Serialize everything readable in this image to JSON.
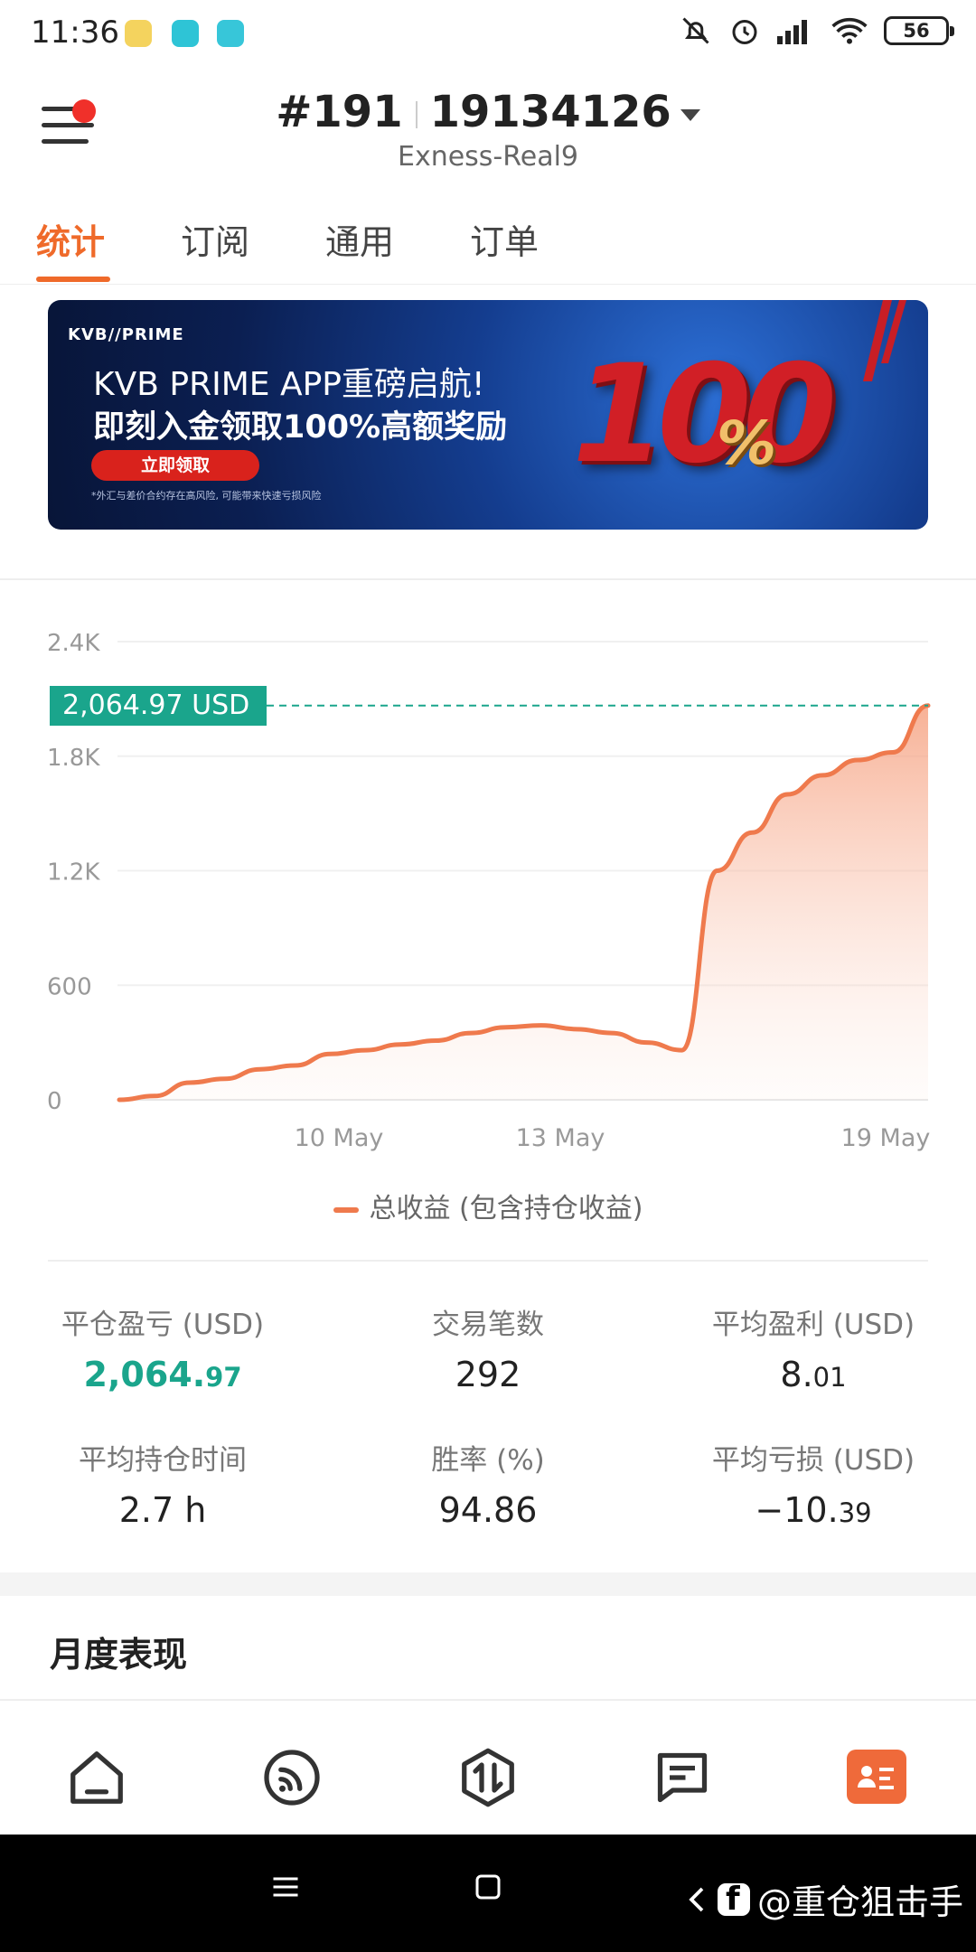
{
  "status_bar": {
    "time": "11:36",
    "battery": "56"
  },
  "header": {
    "account_prefix": "#191",
    "account_number": "19134126",
    "server": "Exness-Real9"
  },
  "tabs": [
    {
      "label": "统计",
      "active": true
    },
    {
      "label": "订阅",
      "active": false
    },
    {
      "label": "通用",
      "active": false
    },
    {
      "label": "订单",
      "active": false
    }
  ],
  "banner": {
    "brand": "KVB//PRIME",
    "line1": "KVB PRIME APP重磅启航!",
    "line2": "即刻入金领取100%高额奖励",
    "button": "立即领取",
    "fine_print": "*外汇与差价合约存在高风险, 可能带来快速亏损风险",
    "big_number": "100",
    "percent": "%"
  },
  "chart_data": {
    "type": "area",
    "y_ticks": [
      "2.4K",
      "1.8K",
      "1.2K",
      "600",
      "0"
    ],
    "x_ticks": [
      "10 May",
      "13 May",
      "19 May"
    ],
    "ylim": [
      0,
      2400
    ],
    "current_value_label": "2,064.97 USD",
    "current_value": 2064.97,
    "series": [
      {
        "name": "总收益 (包含持仓收益)",
        "color": "#ef7a4d",
        "values": [
          0,
          20,
          90,
          110,
          160,
          180,
          240,
          260,
          290,
          310,
          350,
          380,
          390,
          370,
          350,
          300,
          260,
          1200,
          1400,
          1600,
          1700,
          1780,
          1820,
          2064.97
        ]
      }
    ]
  },
  "legend": {
    "label": "总收益 (包含持仓收益)"
  },
  "stats": [
    {
      "label": "平仓盈亏 (USD)",
      "value_main": "2,064.",
      "value_small": "97",
      "color": "green"
    },
    {
      "label": "交易笔数",
      "value_main": "292",
      "value_small": ""
    },
    {
      "label": "平均盈利 (USD)",
      "value_main": "8.",
      "value_small": "01"
    },
    {
      "label": "平均持仓时间",
      "value_main": "2.7 h",
      "value_small": ""
    },
    {
      "label": "胜率 (%)",
      "value_main": "94.86",
      "value_small": ""
    },
    {
      "label": "平均亏损 (USD)",
      "value_main": "−10.",
      "value_small": "39"
    }
  ],
  "monthly": {
    "title": "月度表现"
  },
  "bottom_nav": [
    "home-icon",
    "feed-icon",
    "trade-icon",
    "message-icon",
    "profile-card-icon"
  ],
  "watermark": {
    "text": "@重仓狙击手"
  },
  "colors": {
    "accent": "#ef6a2a",
    "green": "#1aa58c",
    "line": "#ef7a4d"
  }
}
